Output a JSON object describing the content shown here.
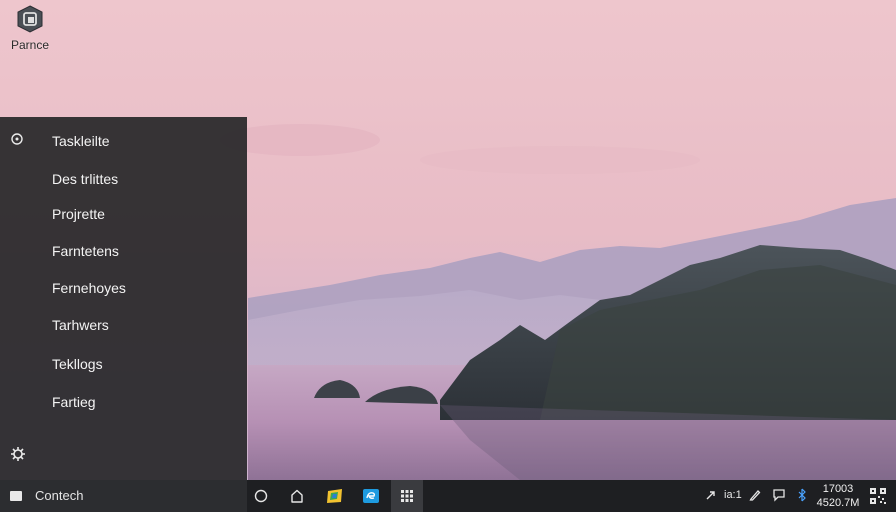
{
  "desktop": {
    "icons": [
      {
        "label": "Parnce",
        "icon": "app-window-icon"
      }
    ]
  },
  "start_menu": {
    "items": [
      {
        "label": "Taskleilte"
      },
      {
        "label": "Des trlittes"
      },
      {
        "label": "Projrette"
      },
      {
        "label": "Farntetens"
      },
      {
        "label": "Fernehoyes"
      },
      {
        "label": "Tarhwers"
      },
      {
        "label": "Tekllogs"
      },
      {
        "label": "Fartieg"
      }
    ],
    "top_icon": "circle-icon",
    "bottom_icon": "settings-gear-icon"
  },
  "taskbar": {
    "search_label": "Contech",
    "search_icon": "square-icon",
    "buttons": [
      {
        "icon": "cortana-circle-icon"
      },
      {
        "icon": "home-icon"
      },
      {
        "icon": "colorful-app-icon"
      },
      {
        "icon": "edge-icon"
      },
      {
        "icon": "grid-app-icon",
        "active": true
      }
    ],
    "tray": {
      "network_label": "ia:1",
      "icons": [
        "arrow-up-icon",
        "pen-icon",
        "chat-icon",
        "bluetooth-icon",
        "qr-icon"
      ]
    },
    "clock": {
      "time": "17003",
      "date": "4520.7M"
    }
  },
  "colors": {
    "panel": "#28282a",
    "taskbar": "#1e1f22",
    "accent_blue": "#1e9be0",
    "sky_top": "#efc7cf",
    "sky_horizon": "#d8b5c8"
  }
}
